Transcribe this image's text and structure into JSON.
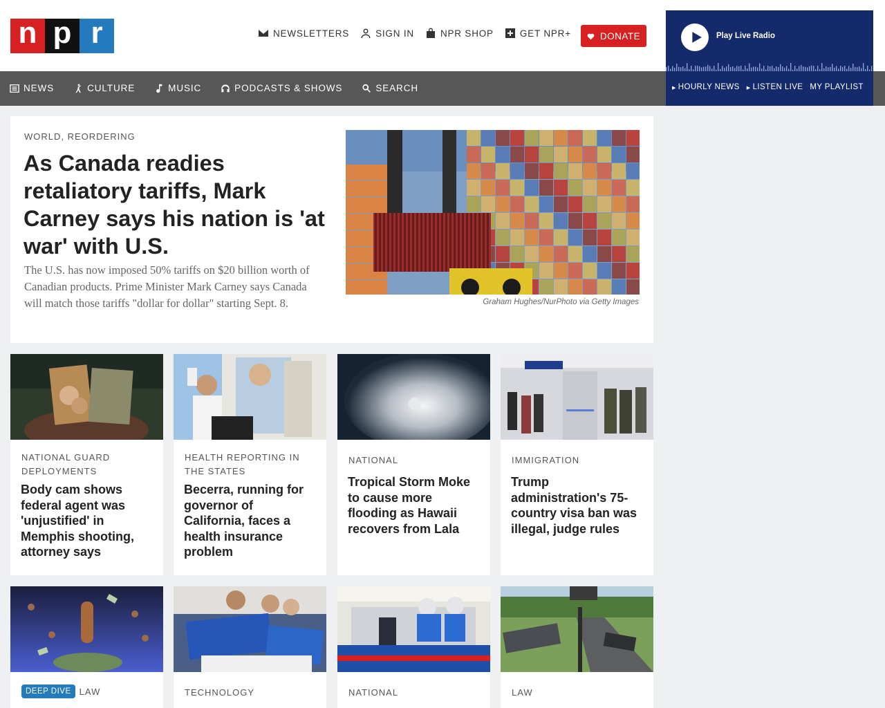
{
  "header": {
    "logo": [
      "n",
      "p",
      "r"
    ],
    "utility": [
      {
        "label": "NEWSLETTERS",
        "icon": "envelope-icon"
      },
      {
        "label": "SIGN IN",
        "icon": "user-icon"
      },
      {
        "label": "NPR SHOP",
        "icon": "bag-icon"
      },
      {
        "label": "GET NPR+",
        "icon": "plus-square-icon"
      }
    ],
    "donate": "DONATE"
  },
  "player": {
    "play_label": "Play Live Radio",
    "links": [
      "HOURLY NEWS",
      "LISTEN LIVE",
      "MY PLAYLIST"
    ]
  },
  "nav": [
    {
      "label": "NEWS",
      "icon": "newspaper-icon"
    },
    {
      "label": "CULTURE",
      "icon": "dancer-icon"
    },
    {
      "label": "MUSIC",
      "icon": "music-note-icon"
    },
    {
      "label": "PODCASTS & SHOWS",
      "icon": "headphones-icon"
    },
    {
      "label": "SEARCH",
      "icon": "search-icon"
    }
  ],
  "hero": {
    "kicker": "WORLD, REORDERING",
    "title": "As Canada readies retaliatory tariffs, Mark Carney says his nation is 'at war' with U.S.",
    "teaser": "The U.S. has now imposed 50% tariffs on $20 billion worth of Canadian products. Prime Minister Mark Carney says Canada will match those tariffs \"dollar for dollar\" starting Sept. 8.",
    "credit": "Graham Hughes/NurPhoto via Getty Images"
  },
  "cards_row1": [
    {
      "kicker": "NATIONAL GUARD DEPLOYMENTS",
      "title": "Body cam shows federal agent was 'unjustified' in Memphis shooting, attorney says"
    },
    {
      "kicker": "HEALTH REPORTING IN THE STATES",
      "title": "Becerra, running for governor of California, faces a health insurance problem"
    },
    {
      "kicker": "NATIONAL",
      "title": "Tropical Storm Moke to cause more flooding as Hawaii recovers from Lala"
    },
    {
      "kicker": "IMMIGRATION",
      "title": "Trump administration's 75-country visa ban was illegal, judge rules"
    }
  ],
  "cards_row2": [
    {
      "badge": "DEEP DIVE",
      "kicker": "LAW"
    },
    {
      "kicker": "TECHNOLOGY"
    },
    {
      "kicker": "NATIONAL"
    },
    {
      "kicker": "LAW"
    }
  ],
  "colors": {
    "brand_red": "#d62021",
    "brand_blue": "#237bbd",
    "player_navy": "#152a6b",
    "nav_gray": "#575757"
  }
}
